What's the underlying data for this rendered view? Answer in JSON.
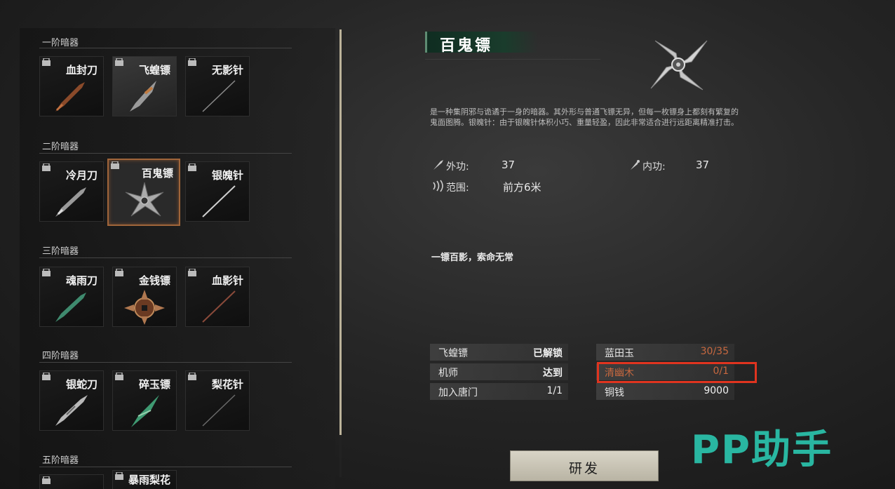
{
  "tiers": [
    {
      "title": "一阶暗器",
      "items": [
        "血封刀",
        "飞蝗镖",
        "无影针"
      ]
    },
    {
      "title": "二阶暗器",
      "items": [
        "冷月刀",
        "百鬼镖",
        "银魄针"
      ]
    },
    {
      "title": "三阶暗器",
      "items": [
        "魂雨刀",
        "金钱镖",
        "血影针"
      ]
    },
    {
      "title": "四阶暗器",
      "items": [
        "银蛇刀",
        "碎玉镖",
        "梨花针"
      ]
    },
    {
      "title": "五阶暗器",
      "items": [
        "",
        "暴雨梨花",
        ""
      ]
    }
  ],
  "detail": {
    "name": "百鬼镖",
    "description": "是一种集阴邪与诡谲于一身的暗器。其外形与普通飞镖无异，但每一枚镖身上都刻有繁复的鬼面图腾。银魄针：由于银魄针体积小巧、重量轻盈，因此非常适合进行远距离精准打击。",
    "outer_label": "外功:",
    "outer_value": "37",
    "inner_label": "内功:",
    "inner_value": "37",
    "range_label": "范围:",
    "range_value": "前方6米",
    "quote": "一镖百影，索命无常"
  },
  "requirements_left": [
    {
      "label": "飞蝗镖",
      "value": "已解锁"
    },
    {
      "label": "机师",
      "value": "达到"
    },
    {
      "label": "加入唐门",
      "value": "1/1"
    }
  ],
  "requirements_right": [
    {
      "label": "蓝田玉",
      "value": "30/35"
    },
    {
      "label": "清幽木",
      "value": "0/1"
    },
    {
      "label": "铜钱",
      "value": "9000"
    }
  ],
  "research_button": "研发",
  "watermark": "PP助手",
  "colors": {
    "accent": "#a0653a",
    "warning": "#c7683f",
    "highlight_box": "#e0341f",
    "banner": "#1a3c2c",
    "watermark": "#2bc7b0"
  }
}
